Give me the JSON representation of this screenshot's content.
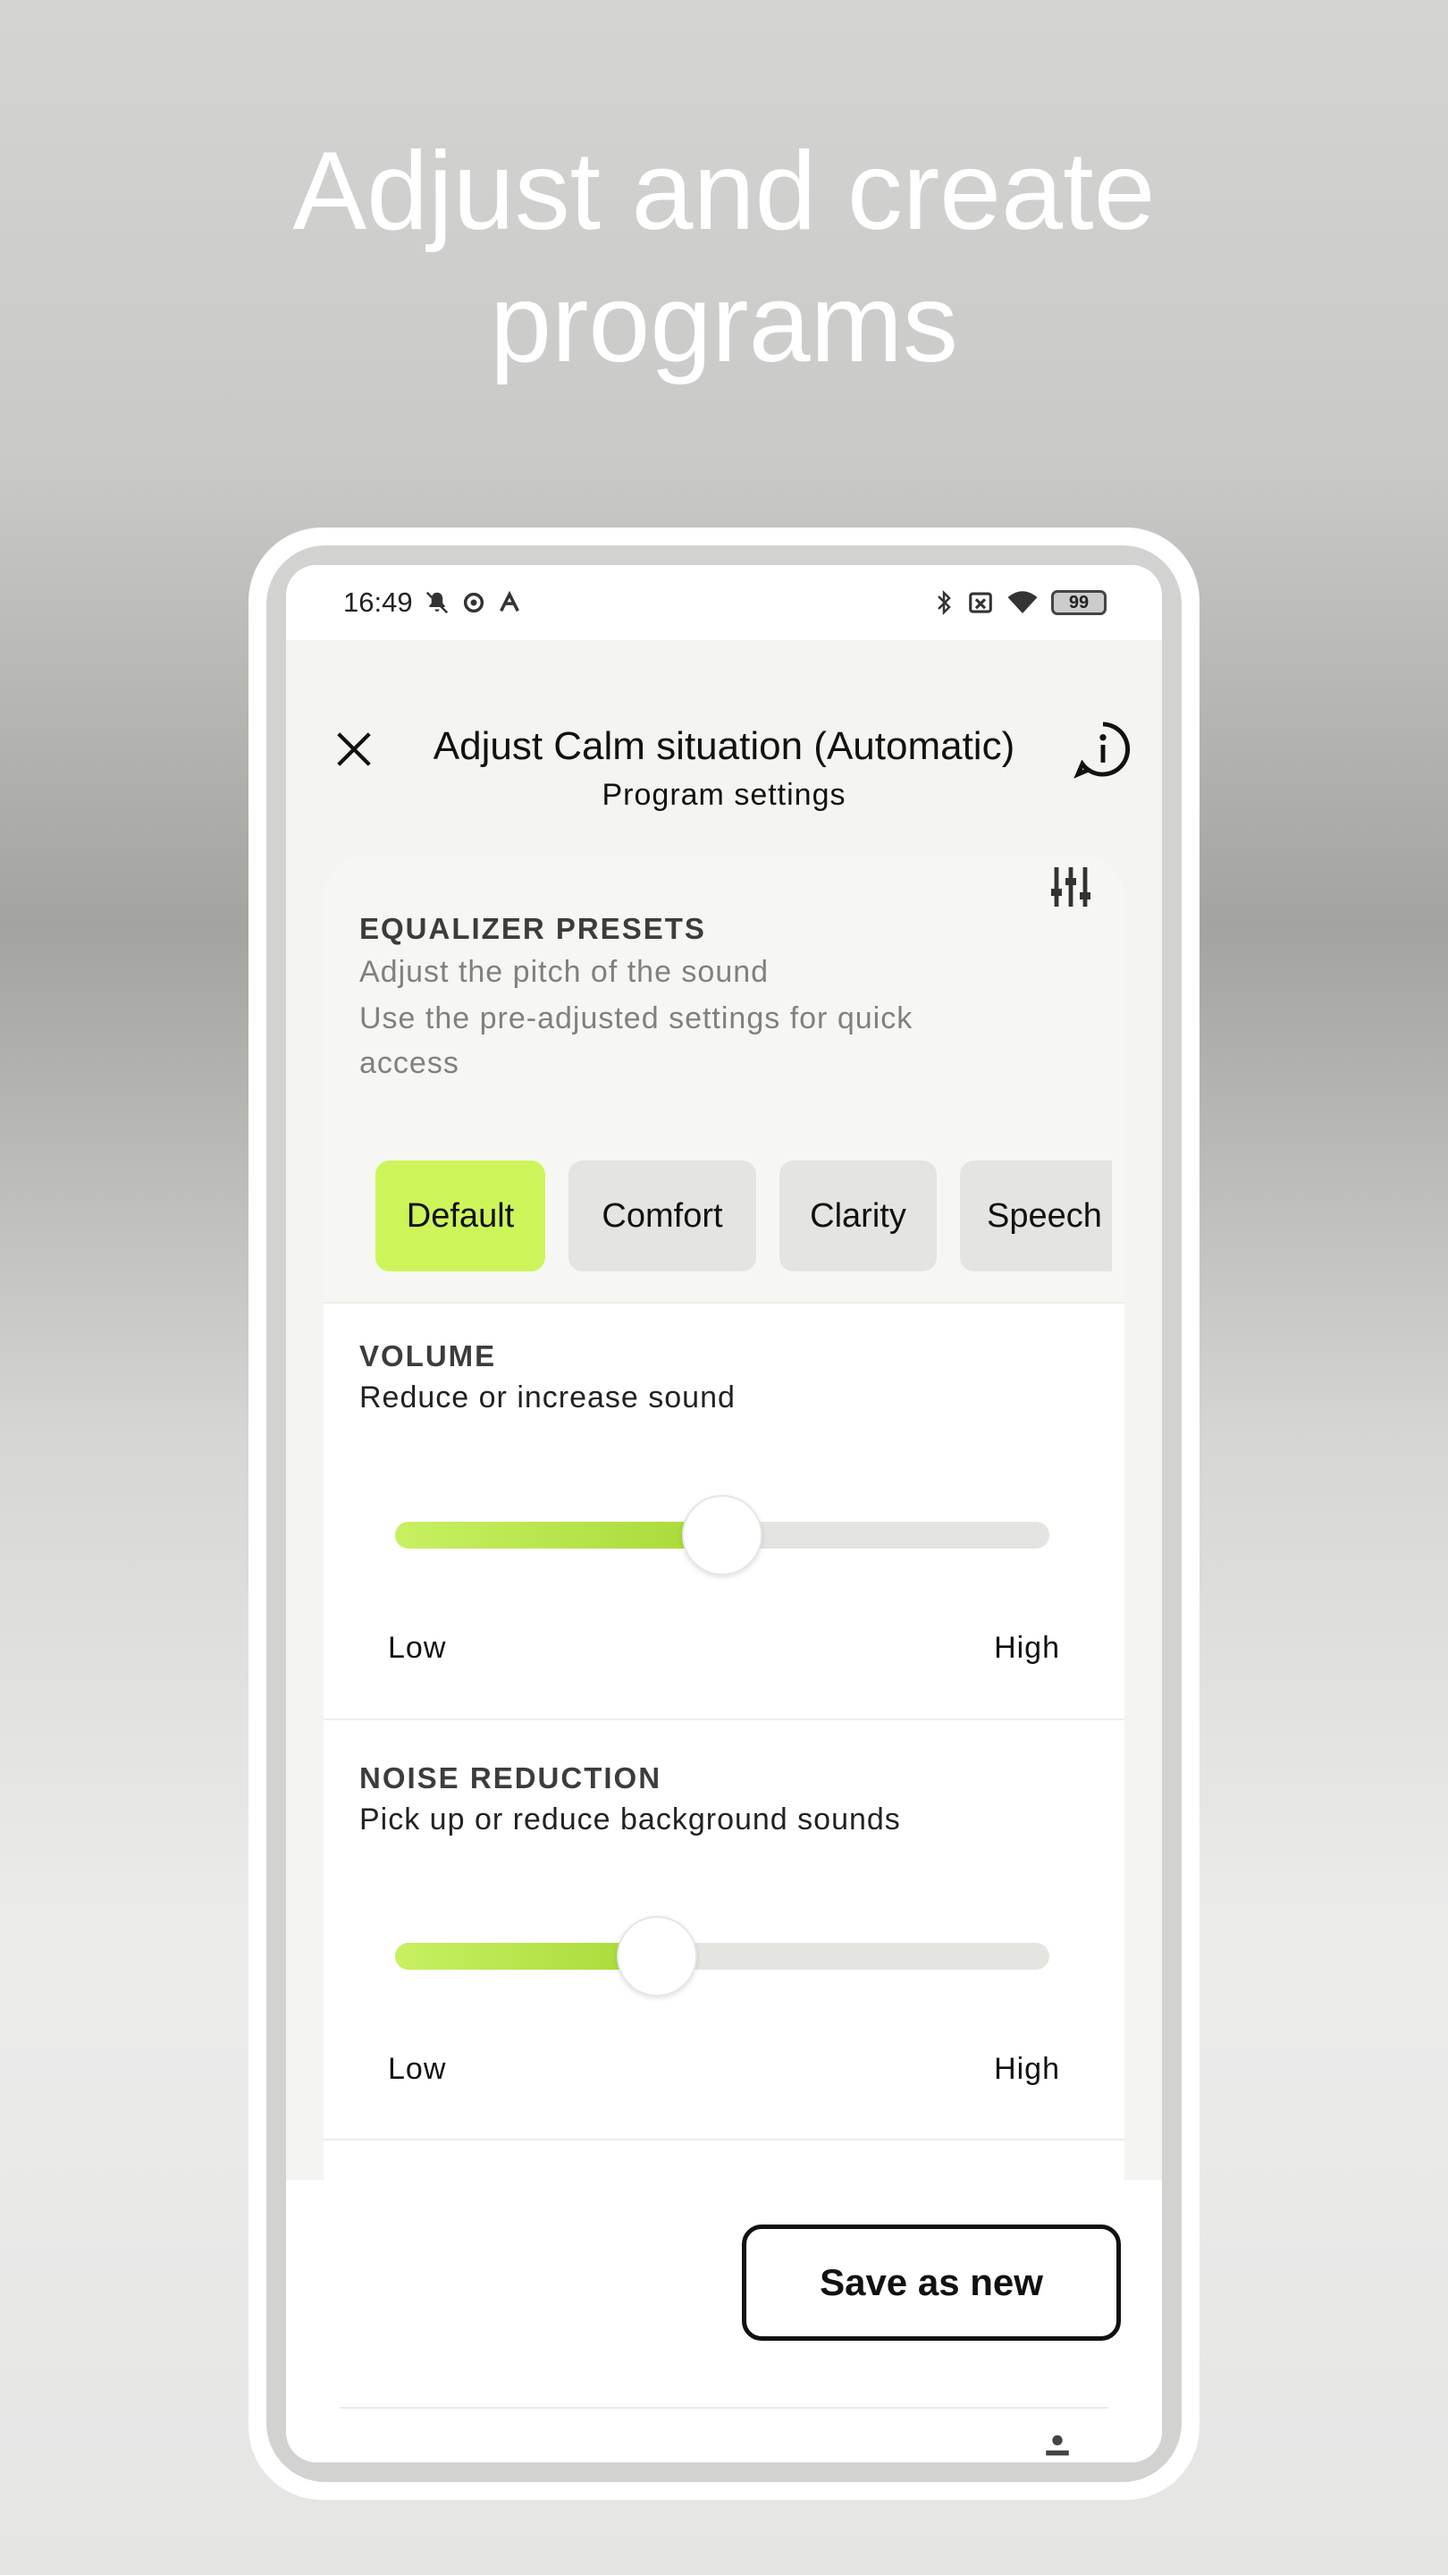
{
  "headline": {
    "line1": "Adjust and create",
    "line2": "programs"
  },
  "status_bar": {
    "time": "16:49",
    "left_icons": [
      "bell-off-icon",
      "app-icon",
      "a-icon"
    ],
    "right_icons": [
      "bluetooth-icon",
      "no-sim-icon",
      "wifi-icon"
    ],
    "battery": "99"
  },
  "header": {
    "title": "Adjust Calm situation (Automatic)",
    "subtitle": "Program settings"
  },
  "equalizer": {
    "title": "EQUALIZER PRESETS",
    "desc1": "Adjust the pitch of the sound",
    "desc2": "Use the pre-adjusted settings for quick access",
    "presets": [
      {
        "label": "Default",
        "selected": true
      },
      {
        "label": "Comfort",
        "selected": false
      },
      {
        "label": "Clarity",
        "selected": false
      },
      {
        "label": "Speech",
        "selected": false
      }
    ]
  },
  "volume": {
    "title": "VOLUME",
    "desc": "Reduce or increase sound",
    "value_fraction": 0.5,
    "low_label": "Low",
    "high_label": "High"
  },
  "noise_reduction": {
    "title": "NOISE REDUCTION",
    "desc": "Pick up or reduce background sounds",
    "value_fraction": 0.4,
    "low_label": "Low",
    "high_label": "High"
  },
  "actions": {
    "save_as_new": "Save as new"
  },
  "colors": {
    "accent": "#cdf55a",
    "chip": "#e4e4e1",
    "text": "#111111"
  }
}
